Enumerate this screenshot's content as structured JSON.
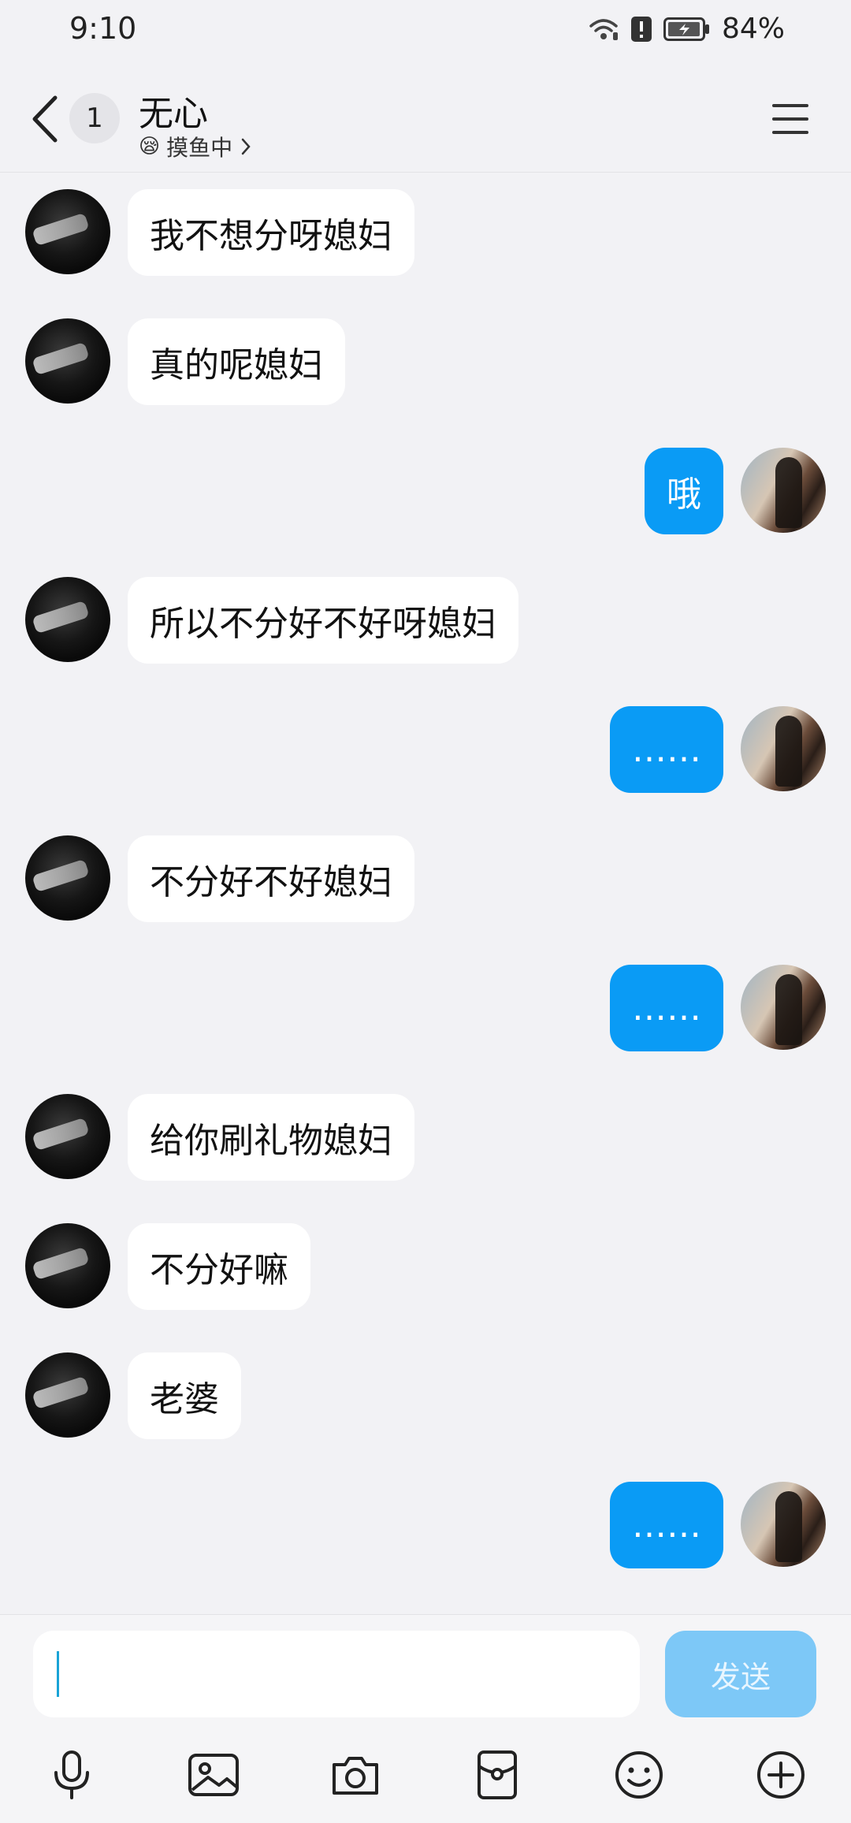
{
  "status_bar": {
    "time": "9:10",
    "battery": "84%"
  },
  "header": {
    "unread_count": "1",
    "title": "无心",
    "status_emoji": "😪",
    "status_text": "摸鱼中"
  },
  "messages": [
    {
      "side": "left",
      "text": "我不想分呀媳妇"
    },
    {
      "side": "left",
      "text": "真的呢媳妇"
    },
    {
      "side": "right",
      "text": "哦"
    },
    {
      "side": "left",
      "text": "所以不分好不好呀媳妇"
    },
    {
      "side": "right",
      "text": "……"
    },
    {
      "side": "left",
      "text": "不分好不好媳妇"
    },
    {
      "side": "right",
      "text": "……"
    },
    {
      "side": "left",
      "text": "给你刷礼物媳妇"
    },
    {
      "side": "left",
      "text": "不分好嘛"
    },
    {
      "side": "left",
      "text": "老婆"
    },
    {
      "side": "right",
      "text": "……"
    }
  ],
  "input": {
    "value": "",
    "send_label": "发送"
  },
  "toolbar": [
    "microphone-icon",
    "image-icon",
    "camera-icon",
    "red-packet-icon",
    "emoji-icon",
    "plus-icon"
  ],
  "colors": {
    "outgoing_bubble": "#0a9bf5",
    "incoming_bubble": "#ffffff",
    "send_button": "#7dc8f7",
    "background": "#f2f2f5"
  }
}
